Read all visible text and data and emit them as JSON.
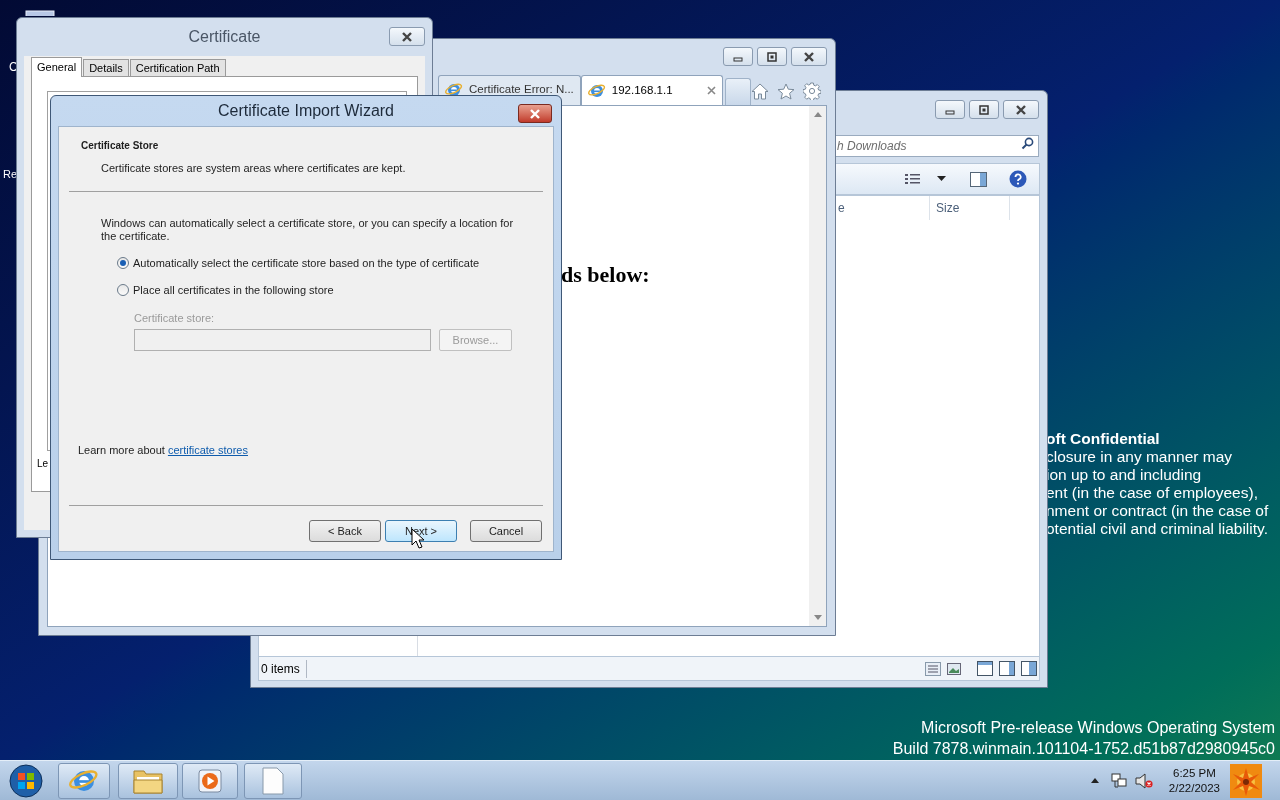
{
  "desktop": {
    "icon_labels": [
      "C",
      "Re"
    ],
    "notice": {
      "title": "oft Confidential",
      "lines": [
        "closure in any manner may",
        "ion up to and including",
        "ent (in the case of employees),",
        "nment or contract (in the case of",
        "otential civil and criminal liability."
      ]
    },
    "build_info": [
      "Microsoft Pre-release Windows Operating System",
      "Build 7878.winmain.101104-1752.d51b87d2980945c0"
    ]
  },
  "explorer": {
    "search": {
      "placeholder": "h Downloads"
    },
    "columns": [
      "e",
      "Size"
    ],
    "status": "0 items"
  },
  "browser": {
    "tabs": [
      {
        "label": "Certificate Error: N...",
        "selected": false
      },
      {
        "label": "192.168.1.1",
        "selected": true
      }
    ],
    "page_text": "ds below:"
  },
  "certificate": {
    "title": "Certificate",
    "tabs": [
      {
        "label": "General",
        "selected": true
      },
      {
        "label": "Details",
        "selected": false
      },
      {
        "label": "Certification Path",
        "selected": false
      }
    ],
    "partial_text": "Le"
  },
  "wizard": {
    "title": "Certificate Import Wizard",
    "heading": "Certificate Store",
    "subheading": "Certificate stores are system areas where certificates are kept.",
    "intro": "Windows can automatically select a certificate store, or you can specify a location for the certificate.",
    "options": [
      {
        "label": "Automatically select the certificate store based on the type of certificate",
        "selected": true
      },
      {
        "label": "Place all certificates in the following store",
        "selected": false
      }
    ],
    "store": {
      "label": "Certificate store:",
      "disabled": true
    },
    "browse": {
      "label": "Browse...",
      "disabled": true
    },
    "learn_more": {
      "text": "Learn more about",
      "link": "certificate stores"
    },
    "buttons": [
      {
        "label": "< Back",
        "hovered": false
      },
      {
        "label": "Next >",
        "hovered": true
      },
      {
        "label": "Cancel",
        "hovered": false
      }
    ]
  },
  "taskbar": {
    "time": "6:25 PM",
    "date": "2/22/2023",
    "volume_muted": true
  }
}
